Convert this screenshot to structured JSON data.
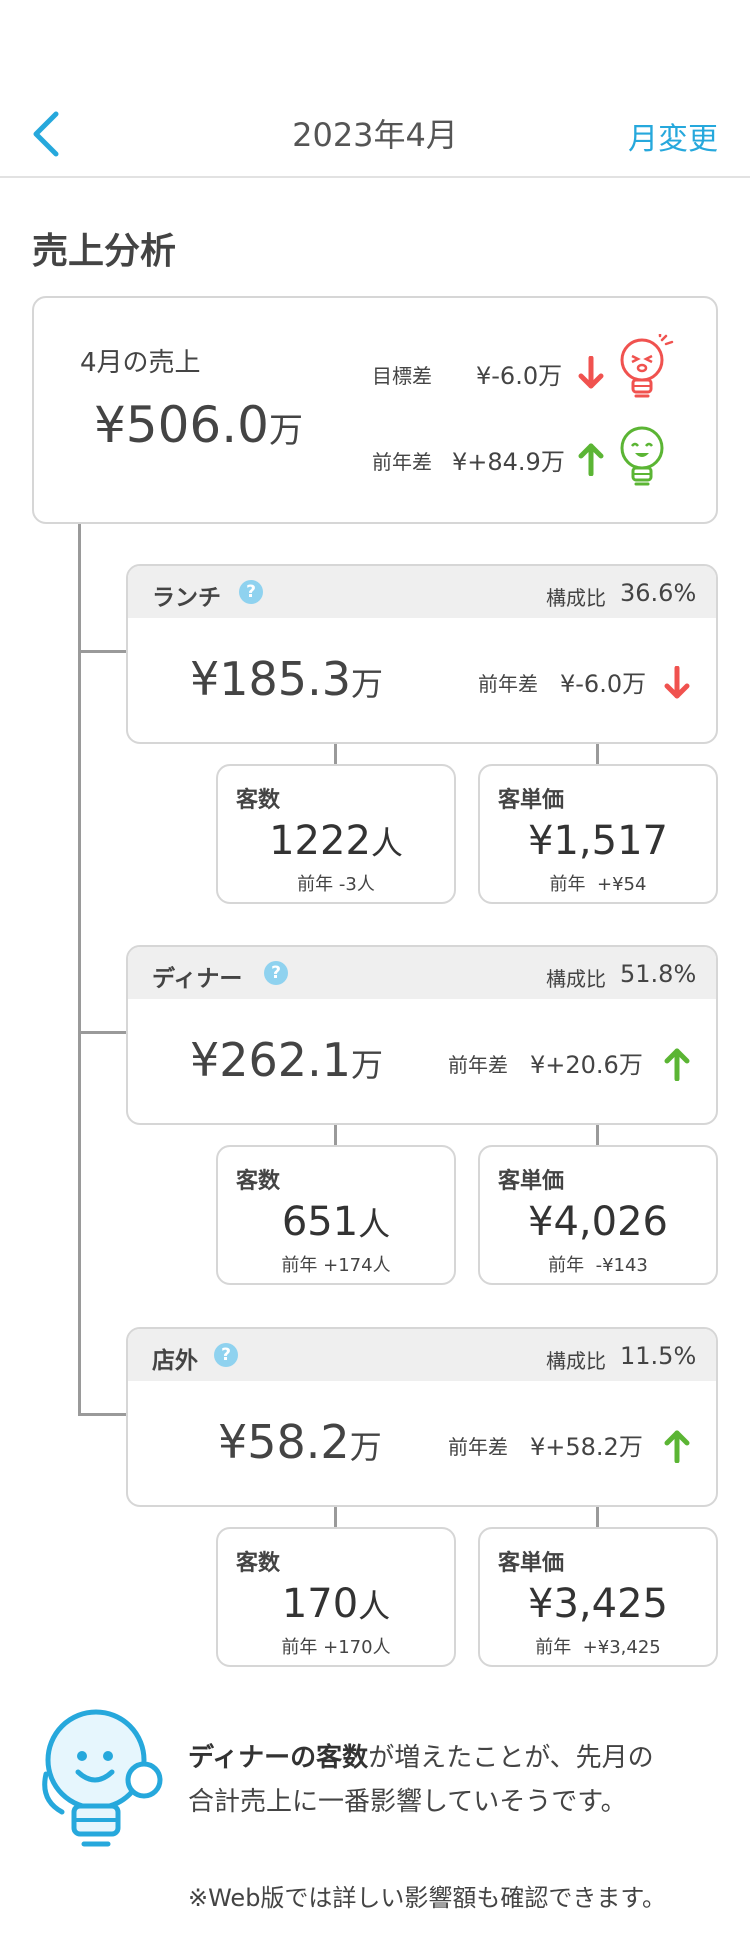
{
  "header": {
    "title": "2023年4月",
    "month_change": "月変更"
  },
  "section_title": "売上分析",
  "summary": {
    "label": "4月の売上",
    "value": "¥506.0",
    "unit": "万",
    "target_diff_label": "目標差",
    "target_diff_value": "¥-6.0万",
    "prev_diff_label": "前年差",
    "prev_diff_value": "¥+84.9万"
  },
  "segments": [
    {
      "name": "ランチ",
      "ratio_label": "構成比",
      "ratio": "36.6%",
      "value": "¥185.3",
      "unit": "万",
      "diff_label": "前年差",
      "diff": "¥-6.0万",
      "trend": "down",
      "customers": {
        "title": "客数",
        "value": "1222",
        "unit": "人",
        "prev": "前年 -3人"
      },
      "unit_price": {
        "title": "客単価",
        "value": "¥1,517",
        "prev": "前年  +¥54"
      }
    },
    {
      "name": "ディナー",
      "ratio_label": "構成比",
      "ratio": "51.8%",
      "value": "¥262.1",
      "unit": "万",
      "diff_label": "前年差",
      "diff": "¥+20.6万",
      "trend": "up",
      "customers": {
        "title": "客数",
        "value": "651",
        "unit": "人",
        "prev": "前年 +174人"
      },
      "unit_price": {
        "title": "客単価",
        "value": "¥4,026",
        "prev": "前年  -¥143"
      }
    },
    {
      "name": "店外",
      "ratio_label": "構成比",
      "ratio": "11.5%",
      "value": "¥58.2",
      "unit": "万",
      "diff_label": "前年差",
      "diff": "¥+58.2万",
      "trend": "up",
      "customers": {
        "title": "客数",
        "value": "170",
        "unit": "人",
        "prev": "前年 +170人"
      },
      "unit_price": {
        "title": "客単価",
        "value": "¥3,425",
        "prev": "前年  +¥3,425"
      }
    }
  ],
  "insight": {
    "bold": "ディナーの客数",
    "text1": "が増えたことが、先月の",
    "text2": "合計売上に一番影響していそうです。",
    "footnote": "※Web版では詳しい影響額も確認できます。"
  },
  "colors": {
    "accent": "#26a8dc",
    "down": "#f0524f",
    "up": "#5bb534",
    "help": "#8fd2ef"
  }
}
